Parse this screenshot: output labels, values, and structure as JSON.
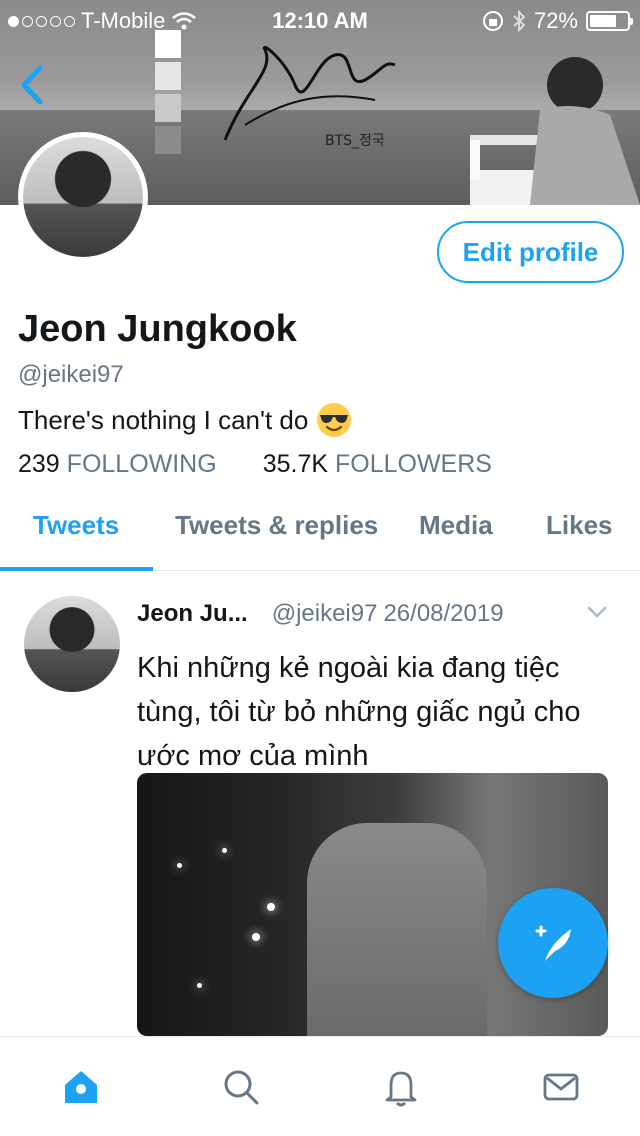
{
  "status_bar": {
    "carrier": "T-Mobile",
    "time": "12:10 AM",
    "battery": "72%",
    "battery_level": 0.72,
    "signal_bars": 1
  },
  "header": {
    "banner_caption": "BTS_정국",
    "icons": [
      "chevron-left-icon"
    ]
  },
  "profile": {
    "edit_label": "Edit profile",
    "name": "Jeon Jungkook",
    "handle": "@jeikei97",
    "bio": "There's nothing I can't do",
    "bio_emoji": "sunglasses-emoji",
    "following_count": "239",
    "following_label": "FOLLOWING",
    "followers_count": "35.7K",
    "followers_label": "FOLLOWERS"
  },
  "tabs": [
    {
      "label": "Tweets",
      "active": true
    },
    {
      "label": "Tweets & replies",
      "active": false
    },
    {
      "label": "Media",
      "active": false
    },
    {
      "label": "Likes",
      "active": false
    }
  ],
  "tweet": {
    "name": "Jeon Ju...",
    "handle": "@jeikei97",
    "date": "26/08/2019",
    "text": "Khi những kẻ ngoài kia đang tiệc tùng, tôi từ bỏ những giấc ngủ cho ước mơ của mình"
  },
  "bottom_nav": {
    "items": [
      "home-icon",
      "search-icon",
      "notifications-icon",
      "messages-icon"
    ],
    "active": "home-icon"
  },
  "colors": {
    "accent": "#1da1f2",
    "secondary_text": "#657786",
    "primary_text": "#14171a"
  }
}
